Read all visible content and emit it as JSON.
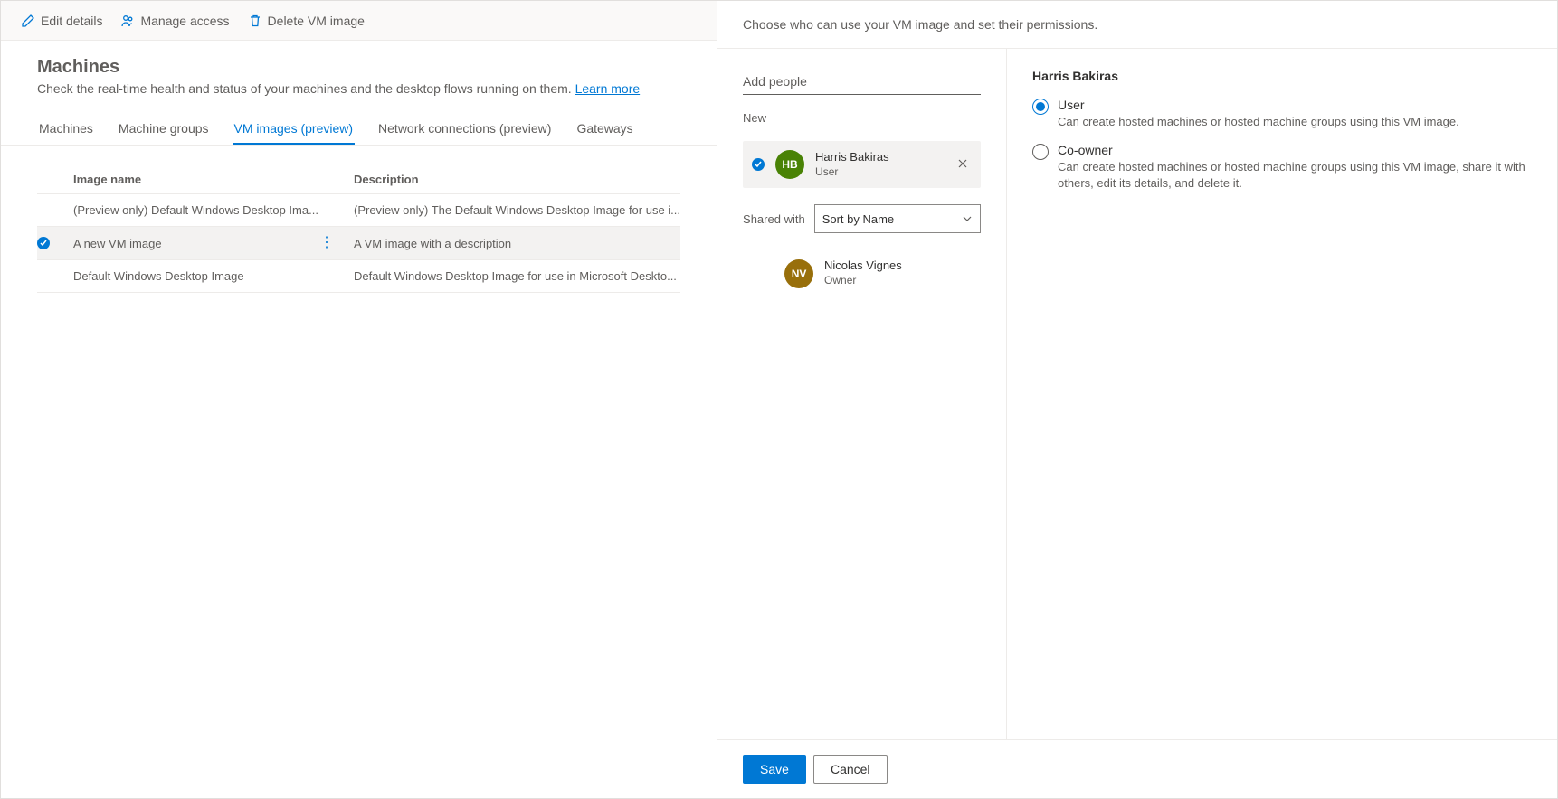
{
  "commandBar": {
    "edit": "Edit details",
    "manageAccess": "Manage access",
    "deleteVm": "Delete VM image"
  },
  "page": {
    "title": "Machines",
    "subtitle": "Check the real-time health and status of your machines and the desktop flows running on them. ",
    "learnMore": "Learn more"
  },
  "tabs": {
    "machines": "Machines",
    "machineGroups": "Machine groups",
    "vmImages": "VM images (preview)",
    "networkConnections": "Network connections (preview)",
    "gateways": "Gateways"
  },
  "table": {
    "headers": {
      "imageName": "Image name",
      "description": "Description"
    },
    "rows": [
      {
        "name": "(Preview only) Default Windows Desktop Ima...",
        "desc": "(Preview only) The Default Windows Desktop Image for use i...",
        "selected": false
      },
      {
        "name": "A new VM image",
        "desc": "A VM image with a description",
        "selected": true
      },
      {
        "name": "Default Windows Desktop Image",
        "desc": "Default Windows Desktop Image for use in Microsoft Deskto...",
        "selected": false
      }
    ]
  },
  "panel": {
    "header": "Choose who can use your VM image and set their permissions.",
    "addPeoplePlaceholder": "Add people",
    "newLabel": "New",
    "newPerson": {
      "initials": "HB",
      "name": "Harris Bakiras",
      "role": "User"
    },
    "sharedWithLabel": "Shared with",
    "sortBy": "Sort by Name",
    "sharedPerson": {
      "initials": "NV",
      "name": "Nicolas Vignes",
      "role": "Owner"
    },
    "permissions": {
      "title": "Harris Bakiras",
      "options": [
        {
          "label": "User",
          "desc": "Can create hosted machines or hosted machine groups using this VM image.",
          "checked": true
        },
        {
          "label": "Co-owner",
          "desc": "Can create hosted machines or hosted machine groups using this VM image, share it with others, edit its details, and delete it.",
          "checked": false
        }
      ]
    },
    "buttons": {
      "save": "Save",
      "cancel": "Cancel"
    }
  }
}
